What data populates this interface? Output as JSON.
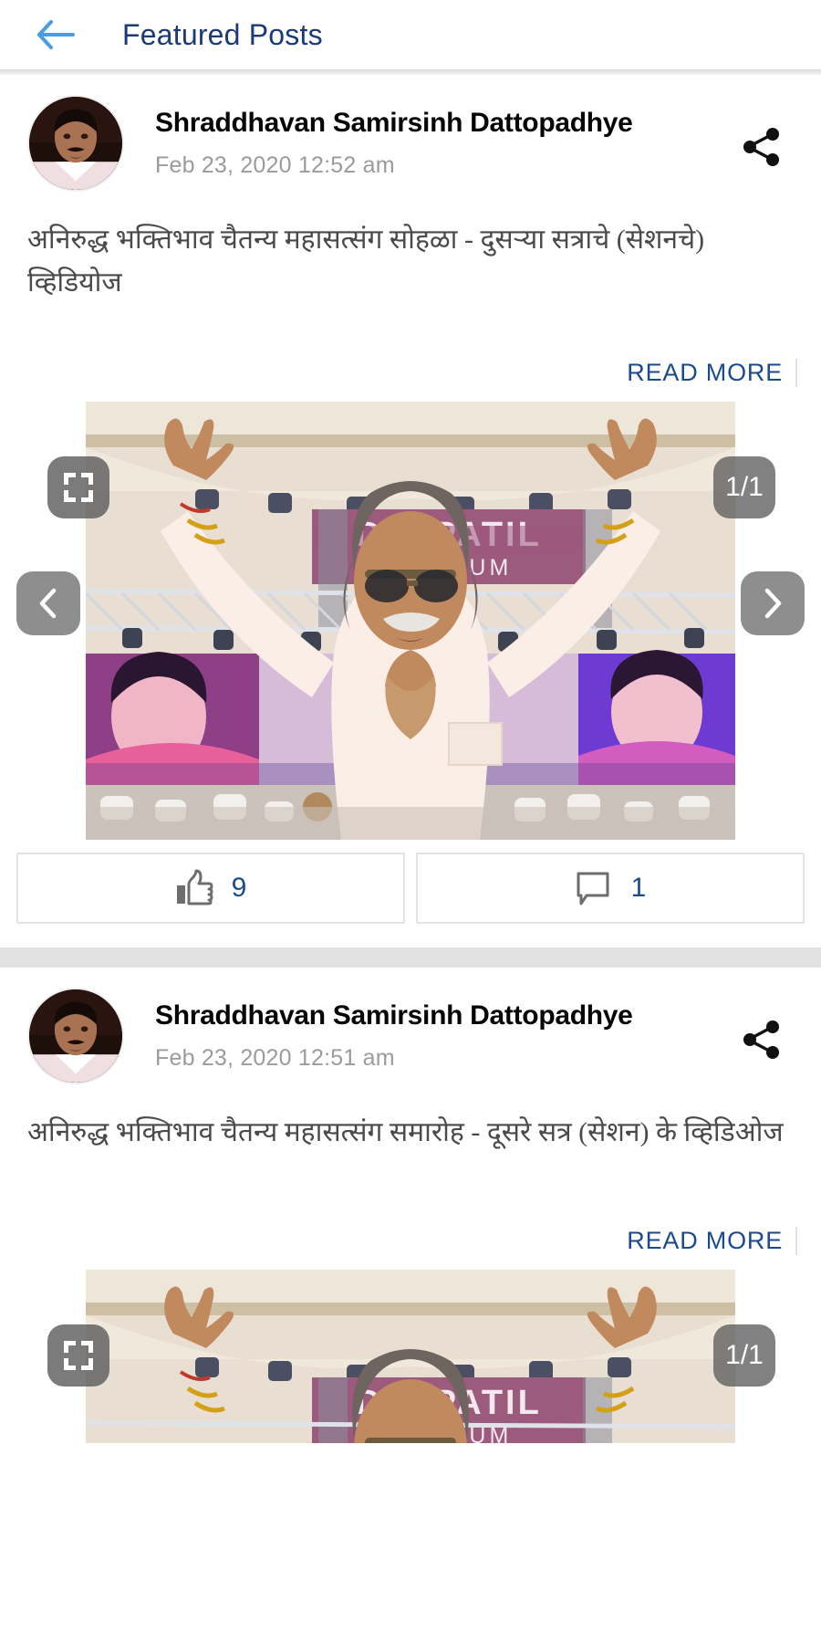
{
  "appbar": {
    "back_icon": "arrow-left-icon",
    "title": "Featured Posts"
  },
  "posts": [
    {
      "author": "Shraddhavan Samirsinh Dattopadhye",
      "timestamp": "Feb 23, 2020 12:52 am",
      "share_icon": "share-icon",
      "body": "अनिरुद्ध भक्तिभाव चैतन्य महासत्संग सोहळा - दुसऱ्या सत्राचे (सेशनचे) व्हिडियोज",
      "read_more": "READ MORE",
      "media": {
        "fullscreen_icon": "fullscreen-icon",
        "counter": "1/1",
        "prev_icon": "chevron-left-icon",
        "next_icon": "chevron-right-icon",
        "sign_line1": "D Y PATIL",
        "sign_line2": "STADIUM"
      },
      "actions": {
        "like_icon": "thumbs-up-icon",
        "like_count": "9",
        "comment_icon": "comment-icon",
        "comment_count": "1"
      }
    },
    {
      "author": "Shraddhavan Samirsinh Dattopadhye",
      "timestamp": "Feb 23, 2020 12:51 am",
      "share_icon": "share-icon",
      "body": "अनिरुद्ध भक्तिभाव चैतन्य महासत्संग समारोह - दूसरे सत्र (सेशन) के व्हिडिओज",
      "read_more": "READ MORE",
      "media": {
        "fullscreen_icon": "fullscreen-icon",
        "counter": "1/1",
        "prev_icon": "chevron-left-icon",
        "next_icon": "chevron-right-icon",
        "sign_line1": "D Y PATIL",
        "sign_line2": "STADIUM"
      }
    }
  ],
  "colors": {
    "accent_blue": "#1b4a8f",
    "title_navy": "#1b3a78",
    "back_arrow": "#4a9de0",
    "divider": "#e2e2e2",
    "feed_bg": "#e2e2e2",
    "sign_magenta": "#9c5a7d"
  }
}
